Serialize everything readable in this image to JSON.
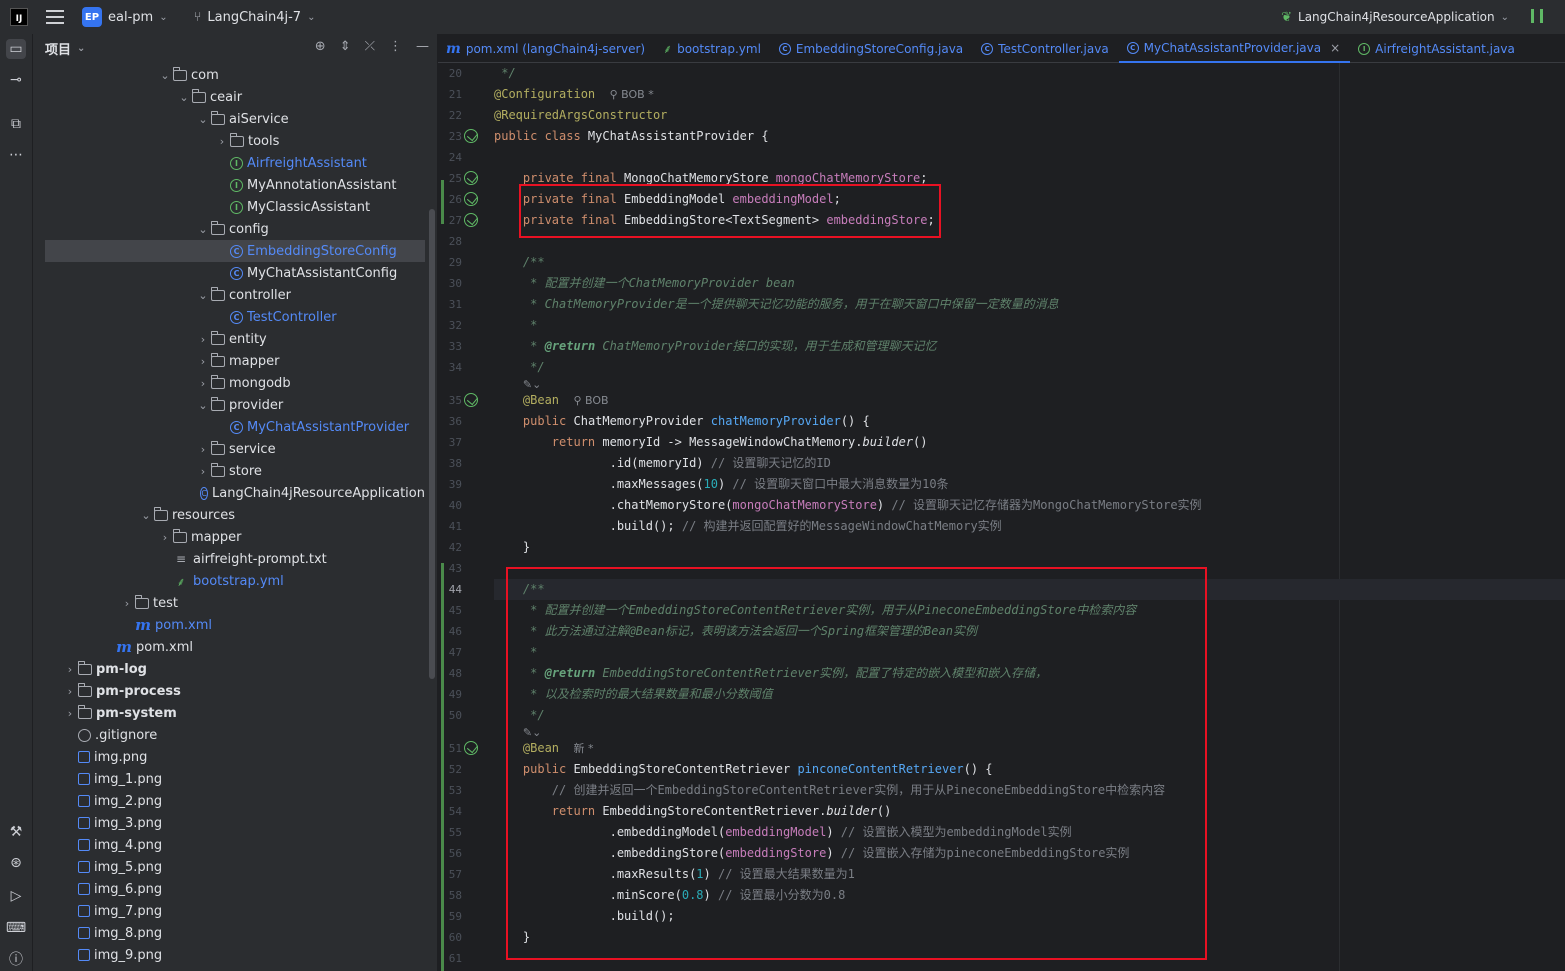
{
  "titlebar": {
    "ide_logo": "IJ",
    "project_badge": "EP",
    "project_name": "eal-pm",
    "branch": "LangChain4j-7",
    "run_config": "LangChain4jResourceApplication"
  },
  "project_panel": {
    "title": "项目",
    "items": [
      {
        "label": "com",
        "depth": 6,
        "arrow": "open",
        "icon": "folder-icon"
      },
      {
        "label": "ceair",
        "depth": 7,
        "arrow": "open",
        "icon": "folder-icon"
      },
      {
        "label": "aiService",
        "depth": 8,
        "arrow": "open",
        "icon": "folder-icon"
      },
      {
        "label": "tools",
        "depth": 9,
        "arrow": "closed",
        "icon": "folder-icon"
      },
      {
        "label": "AirfreightAssistant",
        "depth": 9,
        "arrow": "none",
        "icon": "interface-icon",
        "blue": true
      },
      {
        "label": "MyAnnotationAssistant",
        "depth": 9,
        "arrow": "none",
        "icon": "interface-icon"
      },
      {
        "label": "MyClassicAssistant",
        "depth": 9,
        "arrow": "none",
        "icon": "interface-icon"
      },
      {
        "label": "config",
        "depth": 8,
        "arrow": "open",
        "icon": "folder-icon"
      },
      {
        "label": "EmbeddingStoreConfig",
        "depth": 9,
        "arrow": "none",
        "icon": "class-icon",
        "blue": true,
        "selected": true
      },
      {
        "label": "MyChatAssistantConfig",
        "depth": 9,
        "arrow": "none",
        "icon": "class-icon"
      },
      {
        "label": "controller",
        "depth": 8,
        "arrow": "open",
        "icon": "folder-icon"
      },
      {
        "label": "TestController",
        "depth": 9,
        "arrow": "none",
        "icon": "class-icon",
        "blue": true
      },
      {
        "label": "entity",
        "depth": 8,
        "arrow": "closed",
        "icon": "folder-icon"
      },
      {
        "label": "mapper",
        "depth": 8,
        "arrow": "closed",
        "icon": "folder-icon"
      },
      {
        "label": "mongodb",
        "depth": 8,
        "arrow": "closed",
        "icon": "folder-icon"
      },
      {
        "label": "provider",
        "depth": 8,
        "arrow": "open",
        "icon": "folder-icon"
      },
      {
        "label": "MyChatAssistantProvider",
        "depth": 9,
        "arrow": "none",
        "icon": "class-icon",
        "blue": true
      },
      {
        "label": "service",
        "depth": 8,
        "arrow": "closed",
        "icon": "folder-icon"
      },
      {
        "label": "store",
        "depth": 8,
        "arrow": "closed",
        "icon": "folder-icon"
      },
      {
        "label": "LangChain4jResourceApplication",
        "depth": 8,
        "arrow": "none",
        "icon": "app-icon"
      },
      {
        "label": "resources",
        "depth": 5,
        "arrow": "open",
        "icon": "folder-icon"
      },
      {
        "label": "mapper",
        "depth": 6,
        "arrow": "closed",
        "icon": "folder-icon"
      },
      {
        "label": "airfreight-prompt.txt",
        "depth": 6,
        "arrow": "none",
        "icon": "text-file-icon"
      },
      {
        "label": "bootstrap.yml",
        "depth": 6,
        "arrow": "none",
        "icon": "yaml-icon",
        "blue": true
      },
      {
        "label": "test",
        "depth": 4,
        "arrow": "closed",
        "icon": "folder-icon"
      },
      {
        "label": "pom.xml",
        "depth": 4,
        "arrow": "none",
        "icon": "maven-icon",
        "blue": true
      },
      {
        "label": "pom.xml",
        "depth": 3,
        "arrow": "none",
        "icon": "maven-icon"
      },
      {
        "label": "pm-log",
        "depth": 1,
        "arrow": "closed",
        "icon": "module-icon",
        "bold": true
      },
      {
        "label": "pm-process",
        "depth": 1,
        "arrow": "closed",
        "icon": "module-icon",
        "bold": true
      },
      {
        "label": "pm-system",
        "depth": 1,
        "arrow": "closed",
        "icon": "module-icon",
        "bold": true
      },
      {
        "label": ".gitignore",
        "depth": 1,
        "arrow": "none",
        "icon": "ignore-icon"
      },
      {
        "label": "img.png",
        "depth": 1,
        "arrow": "none",
        "icon": "image-icon"
      },
      {
        "label": "img_1.png",
        "depth": 1,
        "arrow": "none",
        "icon": "image-icon"
      },
      {
        "label": "img_2.png",
        "depth": 1,
        "arrow": "none",
        "icon": "image-icon"
      },
      {
        "label": "img_3.png",
        "depth": 1,
        "arrow": "none",
        "icon": "image-icon"
      },
      {
        "label": "img_4.png",
        "depth": 1,
        "arrow": "none",
        "icon": "image-icon"
      },
      {
        "label": "img_5.png",
        "depth": 1,
        "arrow": "none",
        "icon": "image-icon"
      },
      {
        "label": "img_6.png",
        "depth": 1,
        "arrow": "none",
        "icon": "image-icon"
      },
      {
        "label": "img_7.png",
        "depth": 1,
        "arrow": "none",
        "icon": "image-icon"
      },
      {
        "label": "img_8.png",
        "depth": 1,
        "arrow": "none",
        "icon": "image-icon"
      },
      {
        "label": "img_9.png",
        "depth": 1,
        "arrow": "none",
        "icon": "image-icon"
      }
    ]
  },
  "tabs": [
    {
      "label": "pom.xml (langChain4j-server)",
      "icon": "maven-icon"
    },
    {
      "label": "bootstrap.yml",
      "icon": "yaml-icon"
    },
    {
      "label": "EmbeddingStoreConfig.java",
      "icon": "class-icon"
    },
    {
      "label": "TestController.java",
      "icon": "class-icon"
    },
    {
      "label": "MyChatAssistantProvider.java",
      "icon": "class-icon",
      "active": true
    },
    {
      "label": "AirfreightAssistant.java",
      "icon": "interface-icon"
    }
  ],
  "editor": {
    "lines": [
      {
        "n": "20",
        "html": " <span class=\"doc\">*/</span>"
      },
      {
        "n": "21",
        "html": "<span class=\"an\">@Configuration</span>  <span class=\"meta\">⚲ BOB *</span>"
      },
      {
        "n": "22",
        "html": "<span class=\"an\">@RequiredArgsConstructor</span>"
      },
      {
        "n": "23",
        "html": "<span class=\"kw\">public class</span> MyChatAssistantProvider {",
        "bean": true
      },
      {
        "n": "24",
        "html": ""
      },
      {
        "n": "25",
        "html": "    <span class=\"kw\">private final</span> MongoChatMemoryStore <span class=\"fld\">mongoChatMemoryStore</span>;",
        "bean": true
      },
      {
        "n": "26",
        "html": "    <span class=\"kw\">private final</span> EmbeddingModel <span class=\"fld\">embeddingModel</span>;",
        "bean": true
      },
      {
        "n": "27",
        "html": "    <span class=\"kw\">private final</span> EmbeddingStore&lt;TextSegment&gt; <span class=\"fld\">embeddingStore</span>;",
        "bean": true
      },
      {
        "n": "28",
        "html": ""
      },
      {
        "n": "29",
        "html": "    <span class=\"doc\">/**</span>"
      },
      {
        "n": "30",
        "html": "    <span class=\"doc\"> * 配置并创建一个ChatMemoryProvider bean</span>"
      },
      {
        "n": "31",
        "html": "    <span class=\"doc\"> * ChatMemoryProvider是一个提供聊天记忆功能的服务，用于在聊天窗口中保留一定数量的消息</span>"
      },
      {
        "n": "32",
        "html": "    <span class=\"doc\"> *</span>"
      },
      {
        "n": "33",
        "html": "    <span class=\"doc\"> * </span><span class=\"doctag\">@return</span><span class=\"doc\"> ChatMemoryProvider接口的实现，用于生成和管理聊天记忆</span>"
      },
      {
        "n": "34",
        "html": "    <span class=\"doc\"> */</span>"
      },
      {
        "n": "",
        "html": "    <span class=\"inlay\">✎⌄</span>",
        "half": true
      },
      {
        "n": "35",
        "html": "    <span class=\"an\">@Bean</span>  <span class=\"meta\">⚲ BOB</span>",
        "bean": true
      },
      {
        "n": "36",
        "html": "    <span class=\"kw\">public</span> ChatMemoryProvider <span class=\"fn\">chatMemoryProvider</span>() {"
      },
      {
        "n": "37",
        "html": "        <span class=\"kw\">return</span> memoryId -&gt; MessageWindowChatMemory.<span class=\"it\">builder</span>()"
      },
      {
        "n": "38",
        "html": "                .id(memoryId) <span class=\"cm\">// 设置聊天记忆的ID</span>"
      },
      {
        "n": "39",
        "html": "                .maxMessages(<span class=\"num\">10</span>) <span class=\"cm\">// 设置聊天窗口中最大消息数量为10条</span>"
      },
      {
        "n": "40",
        "html": "                .chatMemoryStore(<span class=\"fld\">mongoChatMemoryStore</span>) <span class=\"cm\">// 设置聊天记忆存储器为MongoChatMemoryStore实例</span>"
      },
      {
        "n": "41",
        "html": "                .build(); <span class=\"cm\">// 构建并返回配置好的MessageWindowChatMemory实例</span>"
      },
      {
        "n": "42",
        "html": "    }"
      },
      {
        "n": "43",
        "html": ""
      },
      {
        "n": "44",
        "html": "    <span class=\"doc\">/**</span>",
        "current": true
      },
      {
        "n": "45",
        "html": "    <span class=\"doc\"> * 配置并创建一个EmbeddingStoreContentRetriever实例，用于从PineconeEmbeddingStore中检索内容</span>"
      },
      {
        "n": "46",
        "html": "    <span class=\"doc\"> * 此方法通过注解@Bean标记，表明该方法会返回一个Spring框架管理的Bean实例</span>"
      },
      {
        "n": "47",
        "html": "    <span class=\"doc\"> *</span>"
      },
      {
        "n": "48",
        "html": "    <span class=\"doc\"> * </span><span class=\"doctag\">@return</span><span class=\"doc\"> EmbeddingStoreContentRetriever实例，配置了特定的嵌入模型和嵌入存储，</span>"
      },
      {
        "n": "49",
        "html": "    <span class=\"doc\"> * 以及检索时的最大结果数量和最小分数阈值</span>"
      },
      {
        "n": "50",
        "html": "    <span class=\"doc\"> */</span>"
      },
      {
        "n": "",
        "html": "    <span class=\"inlay\">✎⌄</span>",
        "half": true
      },
      {
        "n": "51",
        "html": "    <span class=\"an\">@Bean</span>  <span class=\"meta\">新 *</span>",
        "bean": true
      },
      {
        "n": "52",
        "html": "    <span class=\"kw\">public</span> EmbeddingStoreContentRetriever <span class=\"fn\">pinconeContentRetriever</span>() {"
      },
      {
        "n": "53",
        "html": "        <span class=\"cm\">// 创建并返回一个EmbeddingStoreContentRetriever实例，用于从PineconeEmbeddingStore中检索内容</span>"
      },
      {
        "n": "54",
        "html": "        <span class=\"kw\">return</span> EmbeddingStoreContentRetriever.<span class=\"it\">builder</span>()"
      },
      {
        "n": "55",
        "html": "                .embeddingModel(<span class=\"fld\">embeddingModel</span>) <span class=\"cm\">// 设置嵌入模型为embeddingModel实例</span>"
      },
      {
        "n": "56",
        "html": "                .embeddingStore(<span class=\"fld\">embeddingStore</span>) <span class=\"cm\">// 设置嵌入存储为pineconeEmbeddingStore实例</span>"
      },
      {
        "n": "57",
        "html": "                .maxResults(<span class=\"num\">1</span>) <span class=\"cm\">// 设置最大结果数量为1</span>"
      },
      {
        "n": "58",
        "html": "                .minScore(<span class=\"num\">0.8</span>) <span class=\"cm\">// 设置最小分数为0.8</span>"
      },
      {
        "n": "59",
        "html": "                .build();"
      },
      {
        "n": "60",
        "html": "    }"
      },
      {
        "n": "61",
        "html": ""
      }
    ]
  }
}
